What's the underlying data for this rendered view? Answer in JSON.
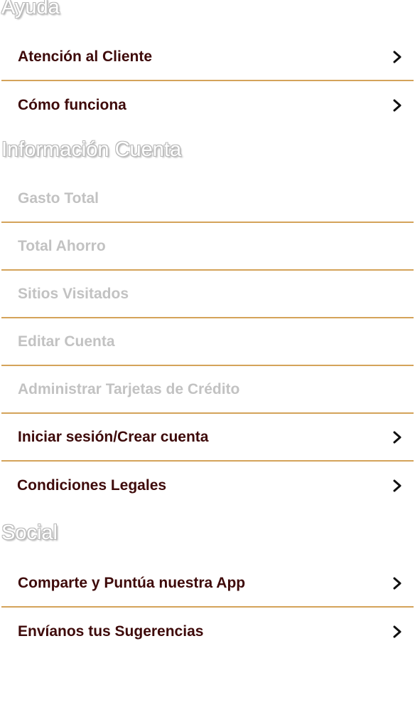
{
  "sections": {
    "help": {
      "title": "Ayuda",
      "items": [
        {
          "label": "Atención al Cliente"
        },
        {
          "label": "Cómo funciona"
        }
      ]
    },
    "account": {
      "title": "Información Cuenta",
      "items": [
        {
          "label": "Gasto Total"
        },
        {
          "label": "Total Ahorro"
        },
        {
          "label": "Sitios Visitados"
        },
        {
          "label": "Editar Cuenta"
        },
        {
          "label": "Administrar Tarjetas de Crédito"
        },
        {
          "label": "Iniciar sesión/Crear cuenta"
        },
        {
          "label": "Condiciones Legales"
        }
      ]
    },
    "social": {
      "title": "Social",
      "items": [
        {
          "label": "Comparte y Puntúa nuestra App"
        },
        {
          "label": "Envíanos tus Sugerencias"
        }
      ]
    }
  },
  "colors": {
    "label_active": "#3e0a0a",
    "label_disabled": "#c2c2c2",
    "divider": "#d4a35a"
  },
  "icons": {
    "row_chevron": "chevron-right-icon"
  }
}
